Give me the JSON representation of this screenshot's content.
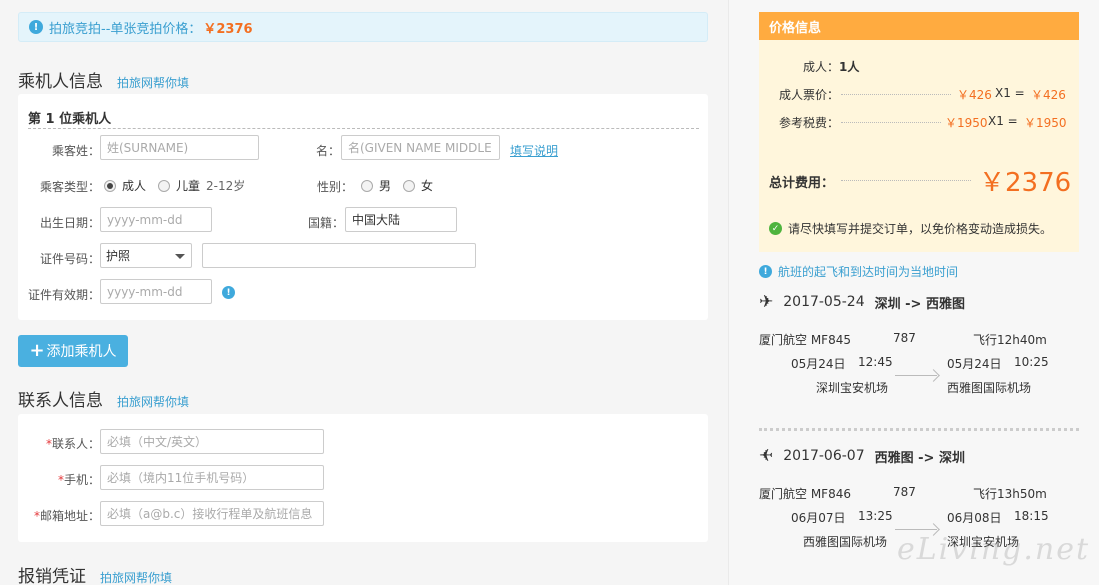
{
  "notice": {
    "text": "拍旅竞拍--单张竞拍价格：",
    "price": "￥2376"
  },
  "passenger_section": {
    "title": "乘机人信息",
    "helper": "拍旅网帮你填"
  },
  "passenger": {
    "title": "第 1 位乘机人",
    "surname_label": "乘客姓：",
    "surname_placeholder": "姓(SURNAME)",
    "given_label": "名：",
    "given_placeholder": "名(GIVEN NAME MIDDLE",
    "fill_guide": "填写说明",
    "type_label": "乘客类型：",
    "type_adult": "成人",
    "type_child": "儿童",
    "type_child_age": "2-12岁",
    "gender_label": "性别：",
    "gender_male": "男",
    "gender_female": "女",
    "birth_label": "出生日期：",
    "birth_placeholder": "yyyy-mm-dd",
    "nationality_label": "国籍：",
    "nationality_value": "中国大陆",
    "id_label": "证件号码：",
    "id_type": "护照",
    "expiry_label": "证件有效期：",
    "expiry_placeholder": "yyyy-mm-dd"
  },
  "add_button": "添加乘机人",
  "contact_section": {
    "title": "联系人信息",
    "helper": "拍旅网帮你填"
  },
  "contact": {
    "name_label": "联系人：",
    "name_placeholder": "必填（中文/英文）",
    "phone_label": "手机：",
    "phone_placeholder": "必填（境内11位手机号码）",
    "email_label": "邮箱地址：",
    "email_placeholder": "必填（a@b.c）接收行程单及航班信息"
  },
  "invoice_section": {
    "title": "报销凭证",
    "helper": "拍旅网帮你填"
  },
  "price_info": {
    "title": "价格信息",
    "adult_count_label": "成人：",
    "adult_count": "1人",
    "fare_label": "成人票价：",
    "fare_unit": "￥426",
    "fare_mult": "X1 =",
    "fare_total": "￥426",
    "tax_label": "参考税费：",
    "tax_unit": "￥1950",
    "tax_mult": "X1 =",
    "tax_total": "￥1950",
    "total_label": "总计费用：",
    "total_value": "￥2376",
    "reminder": "请尽快填写并提交订单，以免价格变动造成损失。"
  },
  "local_time_note": "航班的起飞和到达时间为当地时间",
  "flights": [
    {
      "date": "2017-05-24",
      "route": "深圳 -> 西雅图",
      "airline": "厦门航空 MF845",
      "aircraft": "787",
      "duration": "飞行12h40m",
      "dep_date": "05月24日",
      "dep_time": "12:45",
      "arr_date": "05月24日",
      "arr_time": "10:25",
      "dep_airport": "深圳宝安机场",
      "arr_airport": "西雅图国际机场"
    },
    {
      "date": "2017-06-07",
      "route": "西雅图 -> 深圳",
      "airline": "厦门航空 MF846",
      "aircraft": "787",
      "duration": "飞行13h50m",
      "dep_date": "06月07日",
      "dep_time": "13:25",
      "arr_date": "06月08日",
      "arr_time": "18:15",
      "dep_airport": "西雅图国际机场",
      "arr_airport": "深圳宝安机场"
    }
  ],
  "watermark": "eLiving.net"
}
